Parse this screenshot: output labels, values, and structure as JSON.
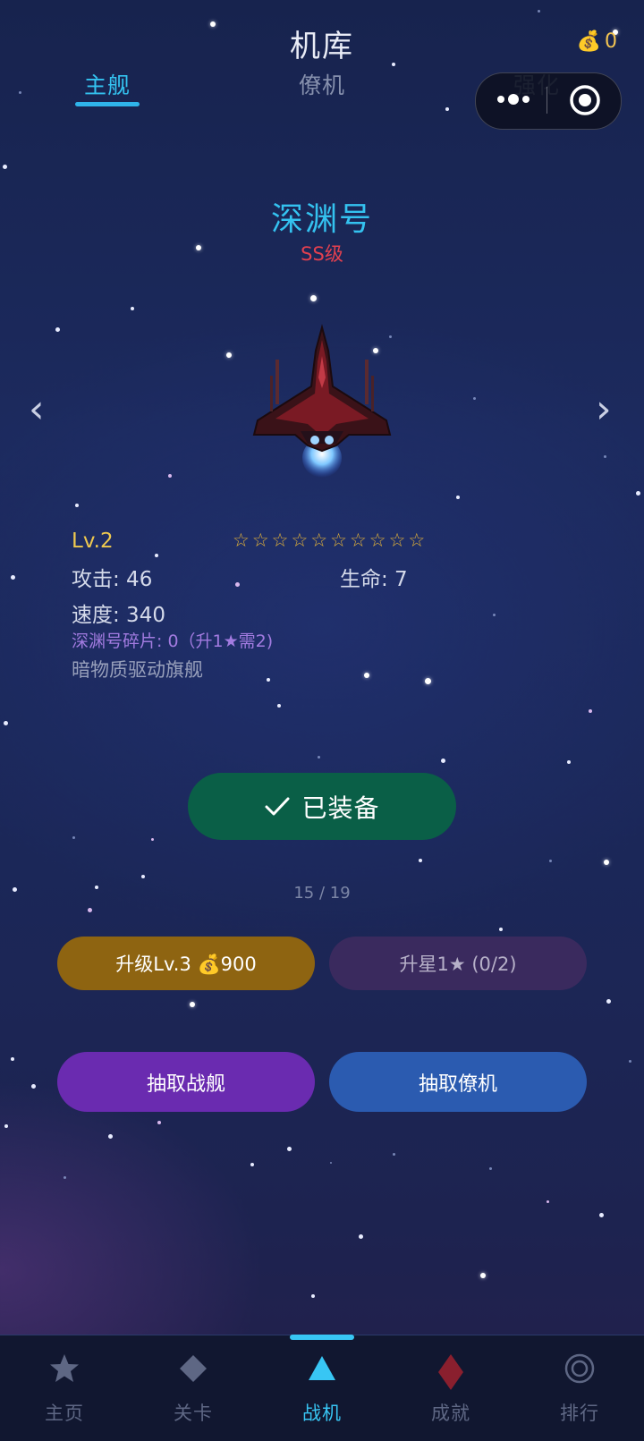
{
  "header": {
    "title": "机库",
    "coin_icon": "money-bag-icon",
    "coin_count": "0"
  },
  "tabs": [
    {
      "label": "主舰",
      "active": true
    },
    {
      "label": "僚机",
      "active": false
    },
    {
      "label": "强化",
      "active": false
    }
  ],
  "miniprogram_capsule": {
    "more_icon": "more-dots-icon",
    "close_icon": "target-circle-icon"
  },
  "ship": {
    "name": "深渊号",
    "grade": "SS级",
    "level": "Lv.2",
    "stars": "☆☆☆☆☆☆☆☆☆☆",
    "attack": "攻击: 46",
    "hp": "生命: 7",
    "speed": "速度: 340",
    "fragments": "深渊号碎片: 0（升1★需2)",
    "description": "暗物质驱动旗舰"
  },
  "carousel": {
    "prev": "‹",
    "next": "›",
    "page_indicator": "15 / 19"
  },
  "actions": {
    "equipped": "已装备",
    "upgrade": "升级Lv.3 💰900",
    "star_up": "升星1★ (0/2)",
    "draw_ship": "抽取战舰",
    "draw_wing": "抽取僚机"
  },
  "bottom_nav": {
    "home": "主页",
    "levels": "关卡",
    "fighter": "战机",
    "achievements": "成就",
    "ranking": "排行",
    "active": "战机"
  },
  "colors": {
    "accent": "#34c2f0",
    "grade": "#e3404f",
    "gold": "#efc94f",
    "equipped_bg": "#0a5f47",
    "upgrade_bg": "#8e6411",
    "star_up_bg": "#3a2a5e",
    "draw_ship_bg": "#6a2bb0",
    "draw_wing_bg": "#2b5bb0"
  }
}
